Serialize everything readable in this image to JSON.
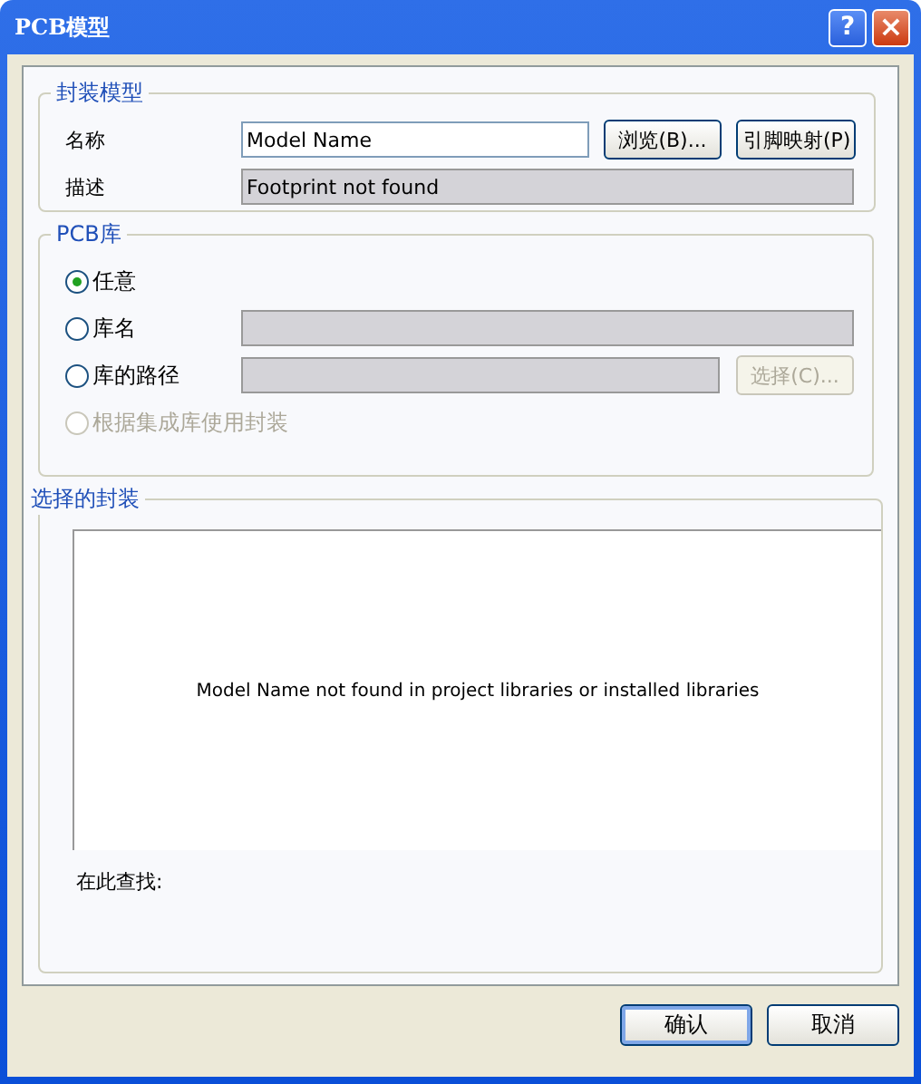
{
  "window": {
    "title": "PCB模型",
    "buttons": [
      {
        "kind": "help",
        "label": "?"
      },
      {
        "kind": "close",
        "label": "×"
      }
    ]
  },
  "footprint_model": {
    "title": "封装模型",
    "name": {
      "label": "名称",
      "value": "Model Name"
    },
    "browse_button": {
      "label": "浏览(B)..."
    },
    "pin_map_button": {
      "label": "引脚映射(P)"
    },
    "description": {
      "label": "描述",
      "value": "Footprint not found",
      "disabled": true
    }
  },
  "pcb_library": {
    "title": "PCB库",
    "options": [
      {
        "label": "任意",
        "selected": true,
        "disabled": false,
        "kind": "plain"
      },
      {
        "label": "库名",
        "selected": false,
        "disabled": false,
        "kind": "field"
      },
      {
        "label": "库的路径",
        "selected": false,
        "disabled": false,
        "kind": "path"
      },
      {
        "label": "根据集成库使用封装",
        "selected": false,
        "disabled": true,
        "kind": "plain"
      }
    ],
    "library_field": {
      "disabled": true
    },
    "path_field": {
      "disabled": true
    },
    "choose_button": {
      "label": "选择(C)...",
      "disabled": true
    }
  },
  "selected_footprint": {
    "title": "选择的封装",
    "message": "Model Name not found in project libraries or installed libraries",
    "found_in_label": "在此查找:"
  },
  "buttons": [
    {
      "label": "确认",
      "default": true
    },
    {
      "label": "取消",
      "default": false
    }
  ]
}
